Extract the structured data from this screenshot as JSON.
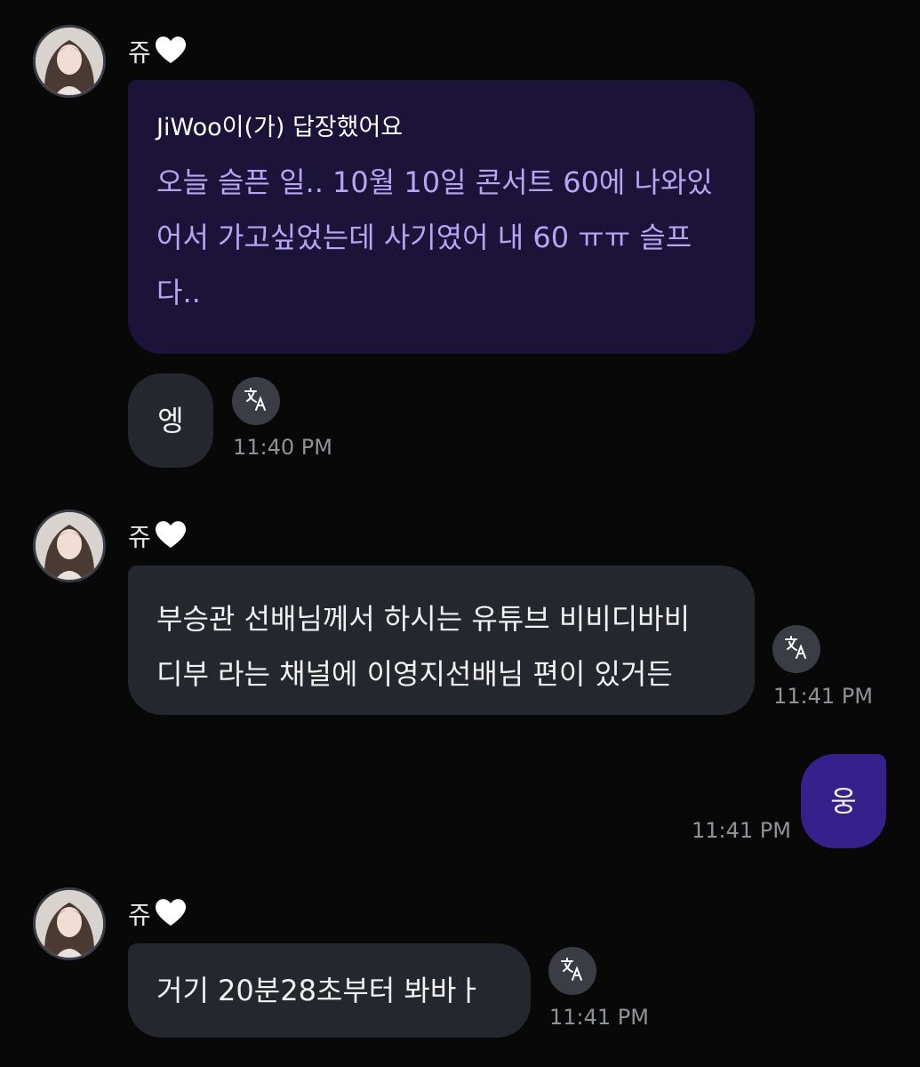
{
  "messages": [
    {
      "sender": "쥬",
      "reply": {
        "header": "JiWoo이(가) 답장했어요",
        "quote_lines": [
          "오늘 슬픈 일.. 10월 10일 콘서트 60에 나와있",
          "어서 가고싶었는데 사기였어 내 60 ㅠㅠ 슬프",
          "다.."
        ]
      },
      "text": "엥",
      "time": "11:40 PM"
    },
    {
      "sender": "쥬",
      "lines": [
        "부승관 선배님께서 하시는 유튜브 비비디바비",
        "디부 라는 채널에 이영지선배님 편이 있거든"
      ],
      "time": "11:41 PM"
    },
    {
      "outgoing": true,
      "text": "웅",
      "time": "11:41 PM"
    },
    {
      "sender": "쥬",
      "text": "거기 20분28초부터 봐바ㅏ",
      "time": "11:41 PM"
    }
  ],
  "icons": {
    "heart": "white-heart-icon",
    "translate": "translate-icon"
  },
  "colors": {
    "background": "#080808",
    "incoming_bubble": "#24272d",
    "reply_bubble": "#1c1338",
    "reply_quote_text": "#b9a4f3",
    "outgoing_bubble": "#35208c",
    "timestamp": "#8e939a"
  }
}
